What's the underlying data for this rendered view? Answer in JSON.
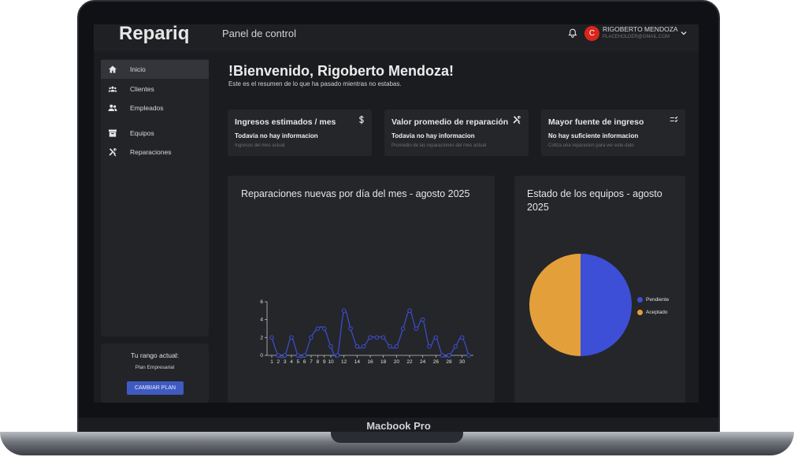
{
  "device": {
    "label": "Macbook Pro"
  },
  "header": {
    "brand": "Repariq",
    "title": "Panel de control",
    "avatar_letter": "C",
    "user_name": "RIGOBERTO MENDOZA",
    "user_email": "PLACEHOLDER@GMAIL.COM"
  },
  "sidebar": {
    "items": [
      {
        "label": "Inicio",
        "icon": "home-icon"
      },
      {
        "label": "Clientes",
        "icon": "clients-icon"
      },
      {
        "label": "Empleados",
        "icon": "employees-icon"
      },
      {
        "label": "Equipos",
        "icon": "equipment-icon"
      },
      {
        "label": "Reparaciones",
        "icon": "tools-icon"
      }
    ],
    "plan_label": "Tu rango actual:",
    "plan_name": "Plan Empresarial",
    "plan_button": "CAMBIAR PLAN"
  },
  "welcome": {
    "title": "!Bienvenido, Rigoberto Mendoza!",
    "subtitle": "Este es el resumen de lo que ha pasado mientras no estabas."
  },
  "cards": [
    {
      "title": "Ingresos estimados / mes",
      "value": "Todavia no hay informacion",
      "desc": "Ingresos del mes actual",
      "icon": "dollar-icon"
    },
    {
      "title": "Valor promedio de reparación",
      "value": "Todavia no hay informacion",
      "desc": "Promedio de las reparaciones del mes actual",
      "icon": "tools-icon"
    },
    {
      "title": "Mayor fuente de ingreso",
      "value": "No hay suficiente informacion",
      "desc": "Cotiza una reparacion para ver este dato",
      "icon": "checklist-icon"
    }
  ],
  "line_panel": {
    "title": "Reparaciones nuevas por día del mes - agosto 2025"
  },
  "pie_panel": {
    "title": "Estado de los equipos - agosto 2025"
  },
  "colors": {
    "line": "#3d4fd6",
    "pending": "#3d4fd6",
    "accepted": "#e3a03a"
  },
  "chart_data": [
    {
      "type": "line",
      "title": "Reparaciones nuevas por día del mes - agosto 2025",
      "x": [
        1,
        2,
        3,
        4,
        5,
        6,
        7,
        8,
        9,
        10,
        11,
        12,
        13,
        14,
        15,
        16,
        17,
        18,
        19,
        20,
        21,
        22,
        23,
        24,
        25,
        26,
        27,
        28,
        29,
        30,
        31
      ],
      "x_ticks": [
        1,
        2,
        3,
        4,
        5,
        6,
        7,
        8,
        9,
        10,
        12,
        14,
        16,
        18,
        20,
        22,
        24,
        26,
        28,
        30
      ],
      "y": [
        2,
        0,
        0,
        2,
        0,
        0,
        2,
        3,
        3,
        1,
        0,
        5,
        3,
        1,
        1,
        2,
        2,
        2,
        1,
        1,
        3,
        5,
        3,
        4,
        1,
        2,
        0,
        0,
        1,
        2,
        0
      ],
      "ylim": [
        0,
        6
      ],
      "y_ticks": [
        0,
        2,
        4,
        6
      ]
    },
    {
      "type": "pie",
      "title": "Estado de los equipos - agosto 2025",
      "labels": [
        "Pendiente",
        "Aceptado"
      ],
      "values": [
        1,
        1
      ],
      "legend": "right"
    }
  ]
}
